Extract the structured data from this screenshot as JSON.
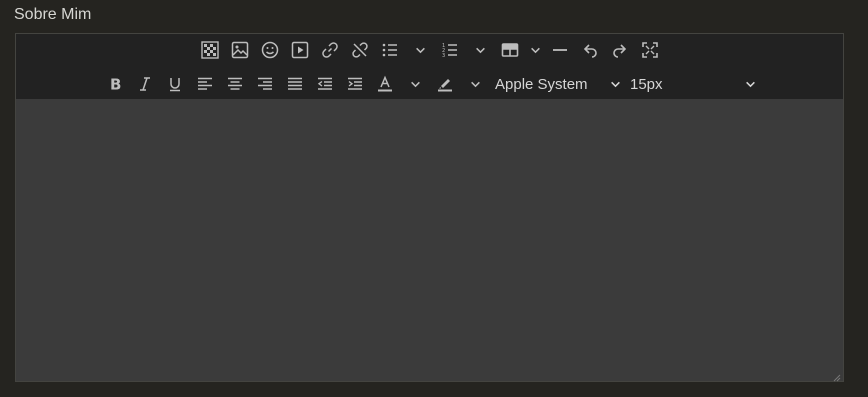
{
  "field": {
    "label": "Sobre Mim"
  },
  "toolbar": {
    "row1": [
      "checkerboard-icon",
      "image-icon",
      "emoji-icon",
      "video-icon",
      "link-icon",
      "unlink-icon",
      "bullet-list-icon",
      "numbered-list-icon",
      "table-icon",
      "horizontal-rule-icon",
      "undo-icon",
      "redo-icon",
      "fullscreen-icon"
    ],
    "row2": [
      "bold-icon",
      "italic-icon",
      "underline-icon",
      "align-left-icon",
      "align-center-icon",
      "align-right-icon",
      "justify-icon",
      "outdent-icon",
      "indent-icon",
      "text-color-icon",
      "highlight-icon"
    ],
    "font_family": "Apple System",
    "font_size": "15px"
  },
  "editor": {
    "content": ""
  }
}
